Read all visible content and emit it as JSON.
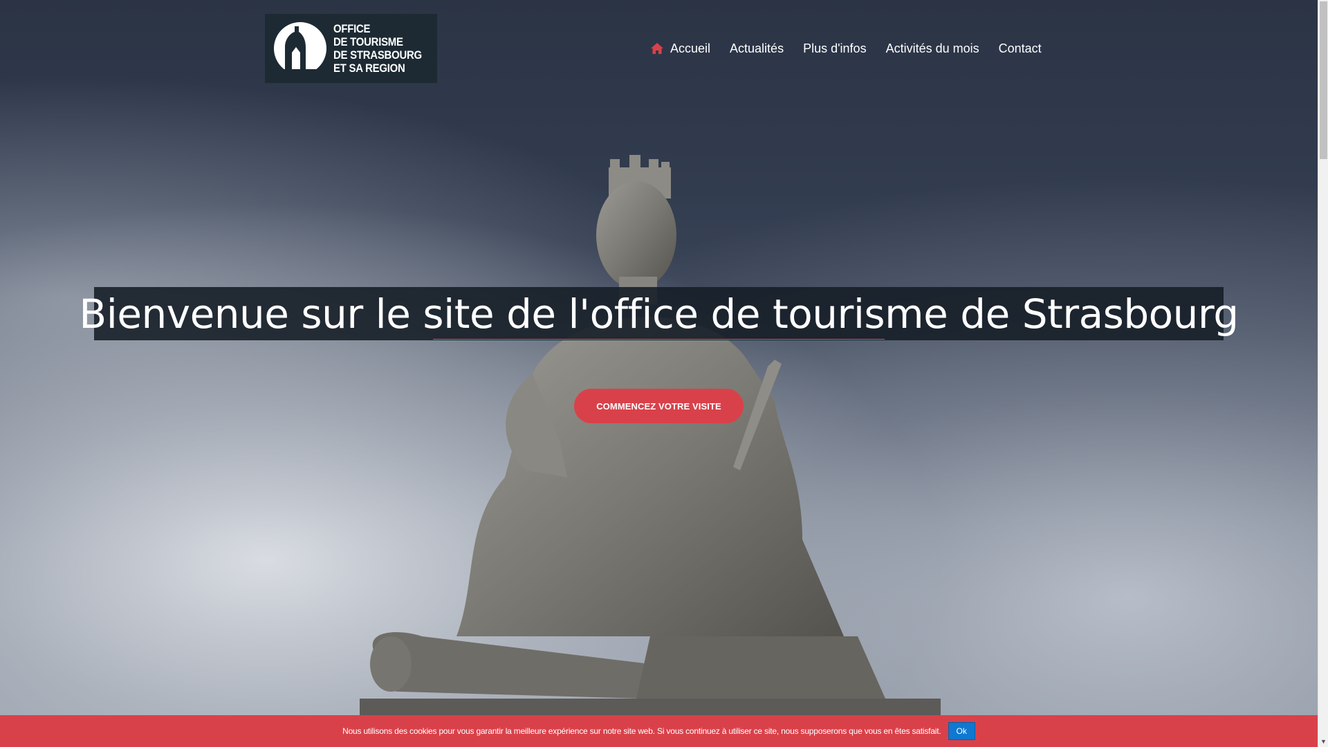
{
  "header": {
    "logo": {
      "lines": [
        "OFFICE",
        "DE TOURISME",
        "DE STRASBOURG",
        "ET SA REGION"
      ],
      "icon": "cathedral-logo-icon"
    },
    "nav": {
      "home_icon": "home-icon",
      "items": [
        "Accueil",
        "Actualités",
        "Plus d'infos",
        "Activités du mois",
        "Contact"
      ]
    }
  },
  "hero": {
    "title": "Bienvenue sur le site de l'office de tourisme de Strasbourg",
    "cta_label": "COMMENCEZ VOTRE VISITE"
  },
  "cookie_bar": {
    "message": "Nous utilisons des cookies pour vous garantir la meilleure expérience sur notre site web. Si vous continuez à utiliser ce site, nous supposerons que vous en êtes satisfait.",
    "ok_label": "Ok"
  },
  "colors": {
    "accent": "#d9414a",
    "logo_bg": "#1d2a33",
    "title_bg": "#141c26",
    "ok_button": "#0f78d1"
  }
}
